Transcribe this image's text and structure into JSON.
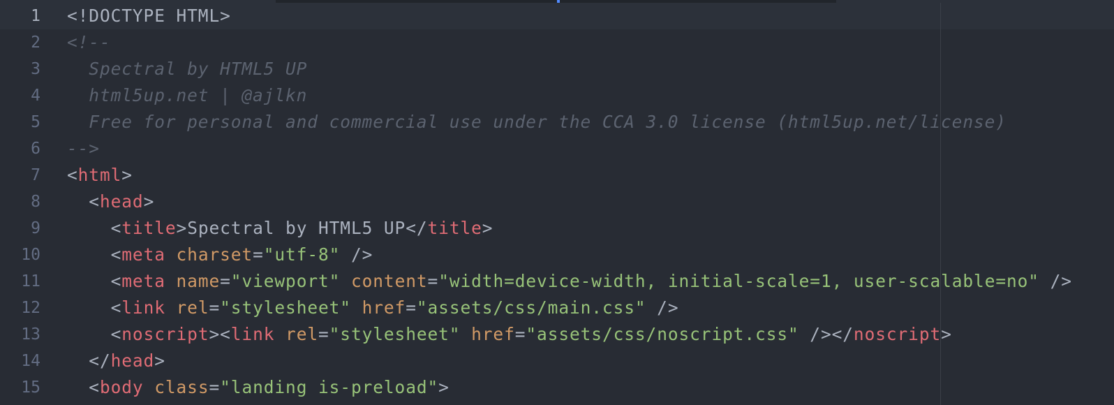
{
  "editor": {
    "theme_colors": {
      "background": "#282c34",
      "gutter_text": "#636d83",
      "text": "#abb2bf",
      "comment": "#5c6370",
      "tag": "#e06c75",
      "attribute": "#d19a66",
      "string": "#98c379",
      "current_line": "#2c313a"
    },
    "current_line": 1,
    "lines": [
      {
        "n": "1",
        "tokens": [
          {
            "c": "plain",
            "t": "<!DOCTYPE HTML>"
          }
        ]
      },
      {
        "n": "2",
        "tokens": [
          {
            "c": "comment",
            "t": "<!--"
          }
        ]
      },
      {
        "n": "3",
        "tokens": [
          {
            "c": "comment",
            "t": "  Spectral by HTML5 UP"
          }
        ]
      },
      {
        "n": "4",
        "tokens": [
          {
            "c": "comment",
            "t": "  html5up.net | @ajlkn"
          }
        ]
      },
      {
        "n": "5",
        "tokens": [
          {
            "c": "comment",
            "t": "  Free for personal and commercial use under the CCA 3.0 license (html5up.net/license)"
          }
        ]
      },
      {
        "n": "6",
        "tokens": [
          {
            "c": "comment",
            "t": "-->"
          }
        ]
      },
      {
        "n": "7",
        "tokens": [
          {
            "c": "punct",
            "t": "<"
          },
          {
            "c": "tag",
            "t": "html"
          },
          {
            "c": "punct",
            "t": ">"
          }
        ]
      },
      {
        "n": "8",
        "tokens": [
          {
            "c": "punct",
            "t": "  <"
          },
          {
            "c": "tag",
            "t": "head"
          },
          {
            "c": "punct",
            "t": ">"
          }
        ]
      },
      {
        "n": "9",
        "tokens": [
          {
            "c": "punct",
            "t": "    <"
          },
          {
            "c": "tag",
            "t": "title"
          },
          {
            "c": "punct",
            "t": ">"
          },
          {
            "c": "plain",
            "t": "Spectral by HTML5 UP"
          },
          {
            "c": "punct",
            "t": "</"
          },
          {
            "c": "tag",
            "t": "title"
          },
          {
            "c": "punct",
            "t": ">"
          }
        ]
      },
      {
        "n": "10",
        "tokens": [
          {
            "c": "punct",
            "t": "    <"
          },
          {
            "c": "tag",
            "t": "meta"
          },
          {
            "c": "plain",
            "t": " "
          },
          {
            "c": "attr",
            "t": "charset"
          },
          {
            "c": "punct",
            "t": "="
          },
          {
            "c": "str",
            "t": "\"utf-8\""
          },
          {
            "c": "punct",
            "t": " />"
          }
        ]
      },
      {
        "n": "11",
        "tokens": [
          {
            "c": "punct",
            "t": "    <"
          },
          {
            "c": "tag",
            "t": "meta"
          },
          {
            "c": "plain",
            "t": " "
          },
          {
            "c": "attr",
            "t": "name"
          },
          {
            "c": "punct",
            "t": "="
          },
          {
            "c": "str",
            "t": "\"viewport\""
          },
          {
            "c": "plain",
            "t": " "
          },
          {
            "c": "attr",
            "t": "content"
          },
          {
            "c": "punct",
            "t": "="
          },
          {
            "c": "str",
            "t": "\"width=device-width, initial-scale=1, user-scalable=no\""
          },
          {
            "c": "punct",
            "t": " />"
          }
        ]
      },
      {
        "n": "12",
        "tokens": [
          {
            "c": "punct",
            "t": "    <"
          },
          {
            "c": "tag",
            "t": "link"
          },
          {
            "c": "plain",
            "t": " "
          },
          {
            "c": "attr",
            "t": "rel"
          },
          {
            "c": "punct",
            "t": "="
          },
          {
            "c": "str",
            "t": "\"stylesheet\""
          },
          {
            "c": "plain",
            "t": " "
          },
          {
            "c": "attr",
            "t": "href"
          },
          {
            "c": "punct",
            "t": "="
          },
          {
            "c": "str",
            "t": "\"assets/css/main.css\""
          },
          {
            "c": "punct",
            "t": " />"
          }
        ]
      },
      {
        "n": "13",
        "tokens": [
          {
            "c": "punct",
            "t": "    <"
          },
          {
            "c": "tag",
            "t": "noscript"
          },
          {
            "c": "punct",
            "t": "><"
          },
          {
            "c": "tag",
            "t": "link"
          },
          {
            "c": "plain",
            "t": " "
          },
          {
            "c": "attr",
            "t": "rel"
          },
          {
            "c": "punct",
            "t": "="
          },
          {
            "c": "str",
            "t": "\"stylesheet\""
          },
          {
            "c": "plain",
            "t": " "
          },
          {
            "c": "attr",
            "t": "href"
          },
          {
            "c": "punct",
            "t": "="
          },
          {
            "c": "str",
            "t": "\"assets/css/noscript.css\""
          },
          {
            "c": "punct",
            "t": " /></"
          },
          {
            "c": "tag",
            "t": "noscript"
          },
          {
            "c": "punct",
            "t": ">"
          }
        ]
      },
      {
        "n": "14",
        "tokens": [
          {
            "c": "punct",
            "t": "  </"
          },
          {
            "c": "tag",
            "t": "head"
          },
          {
            "c": "punct",
            "t": ">"
          }
        ]
      },
      {
        "n": "15",
        "tokens": [
          {
            "c": "punct",
            "t": "  <"
          },
          {
            "c": "tag",
            "t": "body"
          },
          {
            "c": "plain",
            "t": " "
          },
          {
            "c": "attr",
            "t": "class"
          },
          {
            "c": "punct",
            "t": "="
          },
          {
            "c": "str",
            "t": "\"landing is-preload\""
          },
          {
            "c": "punct",
            "t": ">"
          }
        ]
      }
    ]
  }
}
